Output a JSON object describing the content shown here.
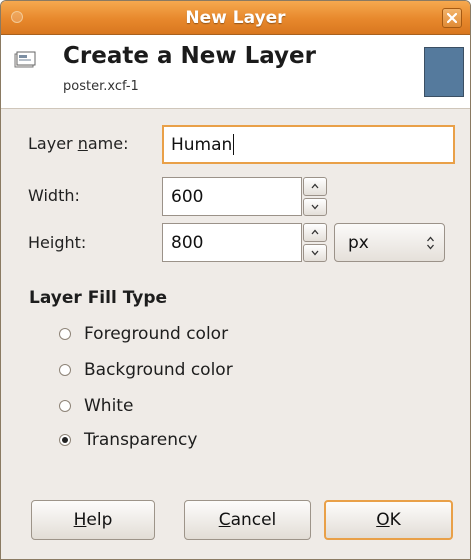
{
  "window": {
    "title": "New Layer",
    "close_label": "×"
  },
  "header": {
    "title": "Create a New Layer",
    "subtitle": "poster.xcf-1",
    "icon": "layer-icon",
    "preview_color": "#557a9d"
  },
  "form": {
    "layer_name_label_pre": "Layer ",
    "layer_name_label_mnemonic": "n",
    "layer_name_label_post": "ame:",
    "layer_name_value": "Human",
    "width_label": "Width:",
    "width_value": "600",
    "height_label": "Height:",
    "height_value": "800",
    "unit_value": "px"
  },
  "fill_type": {
    "title": "Layer Fill Type",
    "options": [
      {
        "label": "Foreground color",
        "selected": false
      },
      {
        "label": "Background color",
        "selected": false
      },
      {
        "label": "White",
        "selected": false
      },
      {
        "label": "Transparency",
        "selected": true
      }
    ]
  },
  "buttons": {
    "help_mnemonic": "H",
    "help_rest": "elp",
    "cancel_mnemonic": "C",
    "cancel_rest": "ancel",
    "ok_mnemonic": "O",
    "ok_rest": "K"
  },
  "colors": {
    "titlebar": "#e7882c",
    "focus_accent": "#e9a048",
    "window_bg": "#efebe7"
  }
}
